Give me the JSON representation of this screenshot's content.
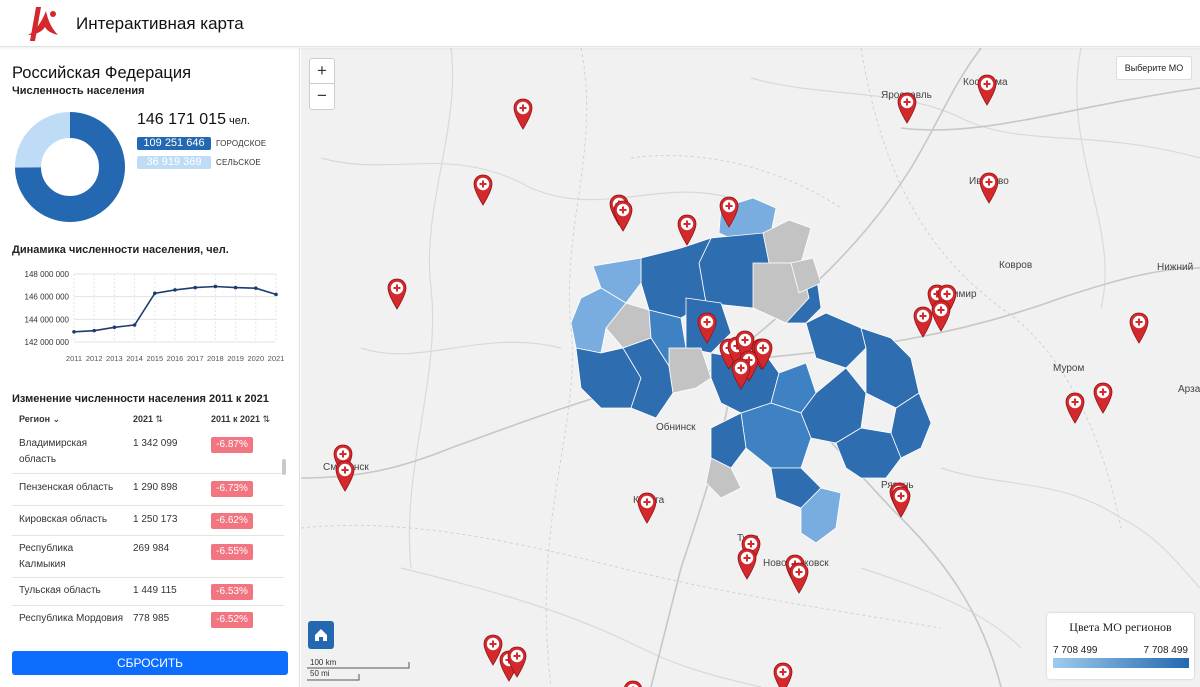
{
  "header": {
    "title": "Интерактивная карта"
  },
  "sidebar": {
    "region_title": "Российская Федерация",
    "population_label": "Численность населения",
    "total_population": "146 171 015",
    "unit": "чел.",
    "urban": {
      "value": "109 251 646",
      "label": "ГОРОДСКОЕ",
      "share": 0.747
    },
    "rural": {
      "value": "36 919 369",
      "label": "СЕЛЬСКОЕ",
      "share": 0.253
    },
    "dynamics_title": "Динамика численности населения, чел.",
    "change_title": "Изменение численности населения 2011 к 2021",
    "table": {
      "headers": {
        "region": "Регион",
        "y2021": "2021",
        "change": "2011 к 2021"
      },
      "rows": [
        {
          "name": "Владимирская область",
          "value": "1 342 099",
          "change": "-6.87%"
        },
        {
          "name": "Пензенская область",
          "value": "1 290 898",
          "change": "-6.73%"
        },
        {
          "name": "Кировская область",
          "value": "1 250 173",
          "change": "-6.62%"
        },
        {
          "name": "Республика Калмыкия",
          "value": "269 984",
          "change": "-6.55%"
        },
        {
          "name": "Тульская область",
          "value": "1 449 115",
          "change": "-6.53%"
        },
        {
          "name": "Республика Мордовия",
          "value": "778 985",
          "change": "-6.52%"
        }
      ]
    },
    "reset_label": "СБРОСИТЬ"
  },
  "chart_data": {
    "type": "line",
    "x": [
      2011,
      2012,
      2013,
      2014,
      2015,
      2016,
      2017,
      2018,
      2019,
      2020,
      2021
    ],
    "series": [
      {
        "values": [
          142900000,
          143000000,
          143300000,
          143500000,
          146300000,
          146600000,
          146800000,
          146900000,
          146800000,
          146750000,
          146200000
        ]
      }
    ],
    "yticks": [
      "148 000 000",
      "146 000 000",
      "144 000 000",
      "142 000 000"
    ],
    "ylim": [
      142000000,
      148000000
    ],
    "title": "Динамика численности населения, чел.",
    "grid": true
  },
  "map": {
    "zoom_in": "+",
    "zoom_out": "−",
    "select_mo": "Выберите МО",
    "scale_km": "100 km",
    "scale_mi": "50 mi",
    "legend": {
      "title": "Цвета МО регионов",
      "min": "7 708 499",
      "max": "7 708 499"
    },
    "labels": [
      "Ярославль",
      "Кострома",
      "Иваново",
      "Ковров",
      "Нижний",
      "Владимир",
      "Муром",
      "Обнинск",
      "Смоленск",
      "Калуга",
      "Рязань",
      "Тула",
      "Новомосковск",
      "Арзамас"
    ],
    "colors": {
      "dark": "#2e6db0",
      "mid": "#3f82c4",
      "light": "#7aaddf",
      "gray": "#c3c3c3",
      "marker": "#d3282c"
    }
  }
}
